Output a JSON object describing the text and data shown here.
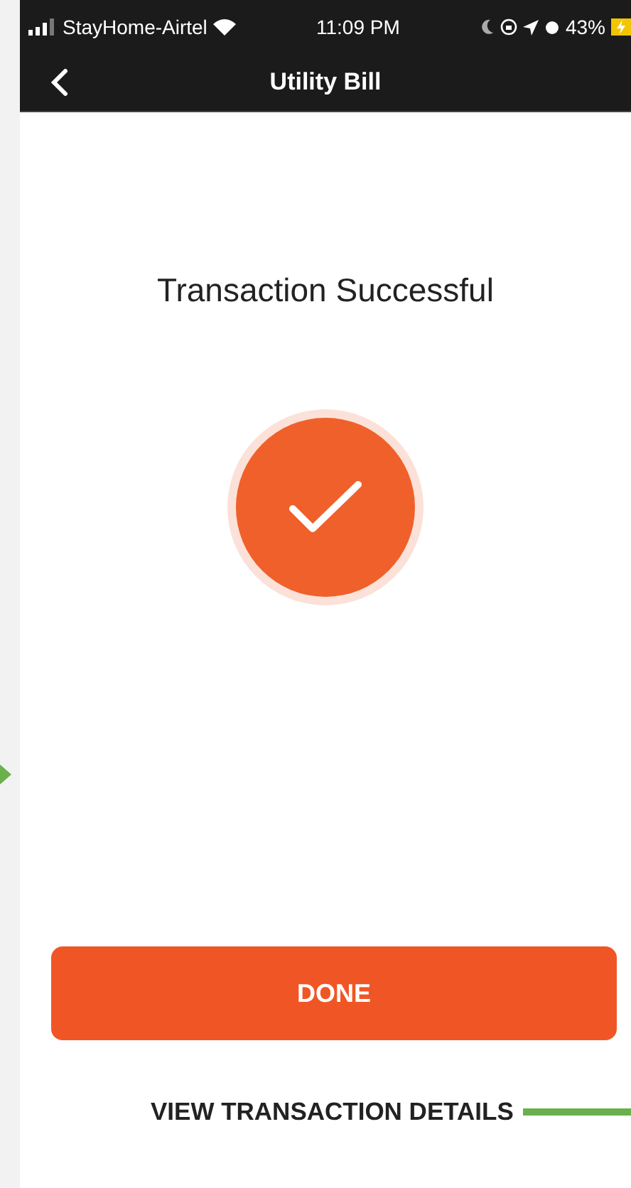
{
  "status_bar": {
    "carrier": "StayHome-Airtel",
    "time": "11:09 PM",
    "battery": "43%"
  },
  "nav": {
    "title": "Utility Bill"
  },
  "result": {
    "message": "Transaction Successful"
  },
  "buttons": [
    {
      "label": "DONE",
      "kind": "primary"
    },
    {
      "label": "VIEW TRANSACTION DETAILS",
      "kind": "link"
    }
  ]
}
